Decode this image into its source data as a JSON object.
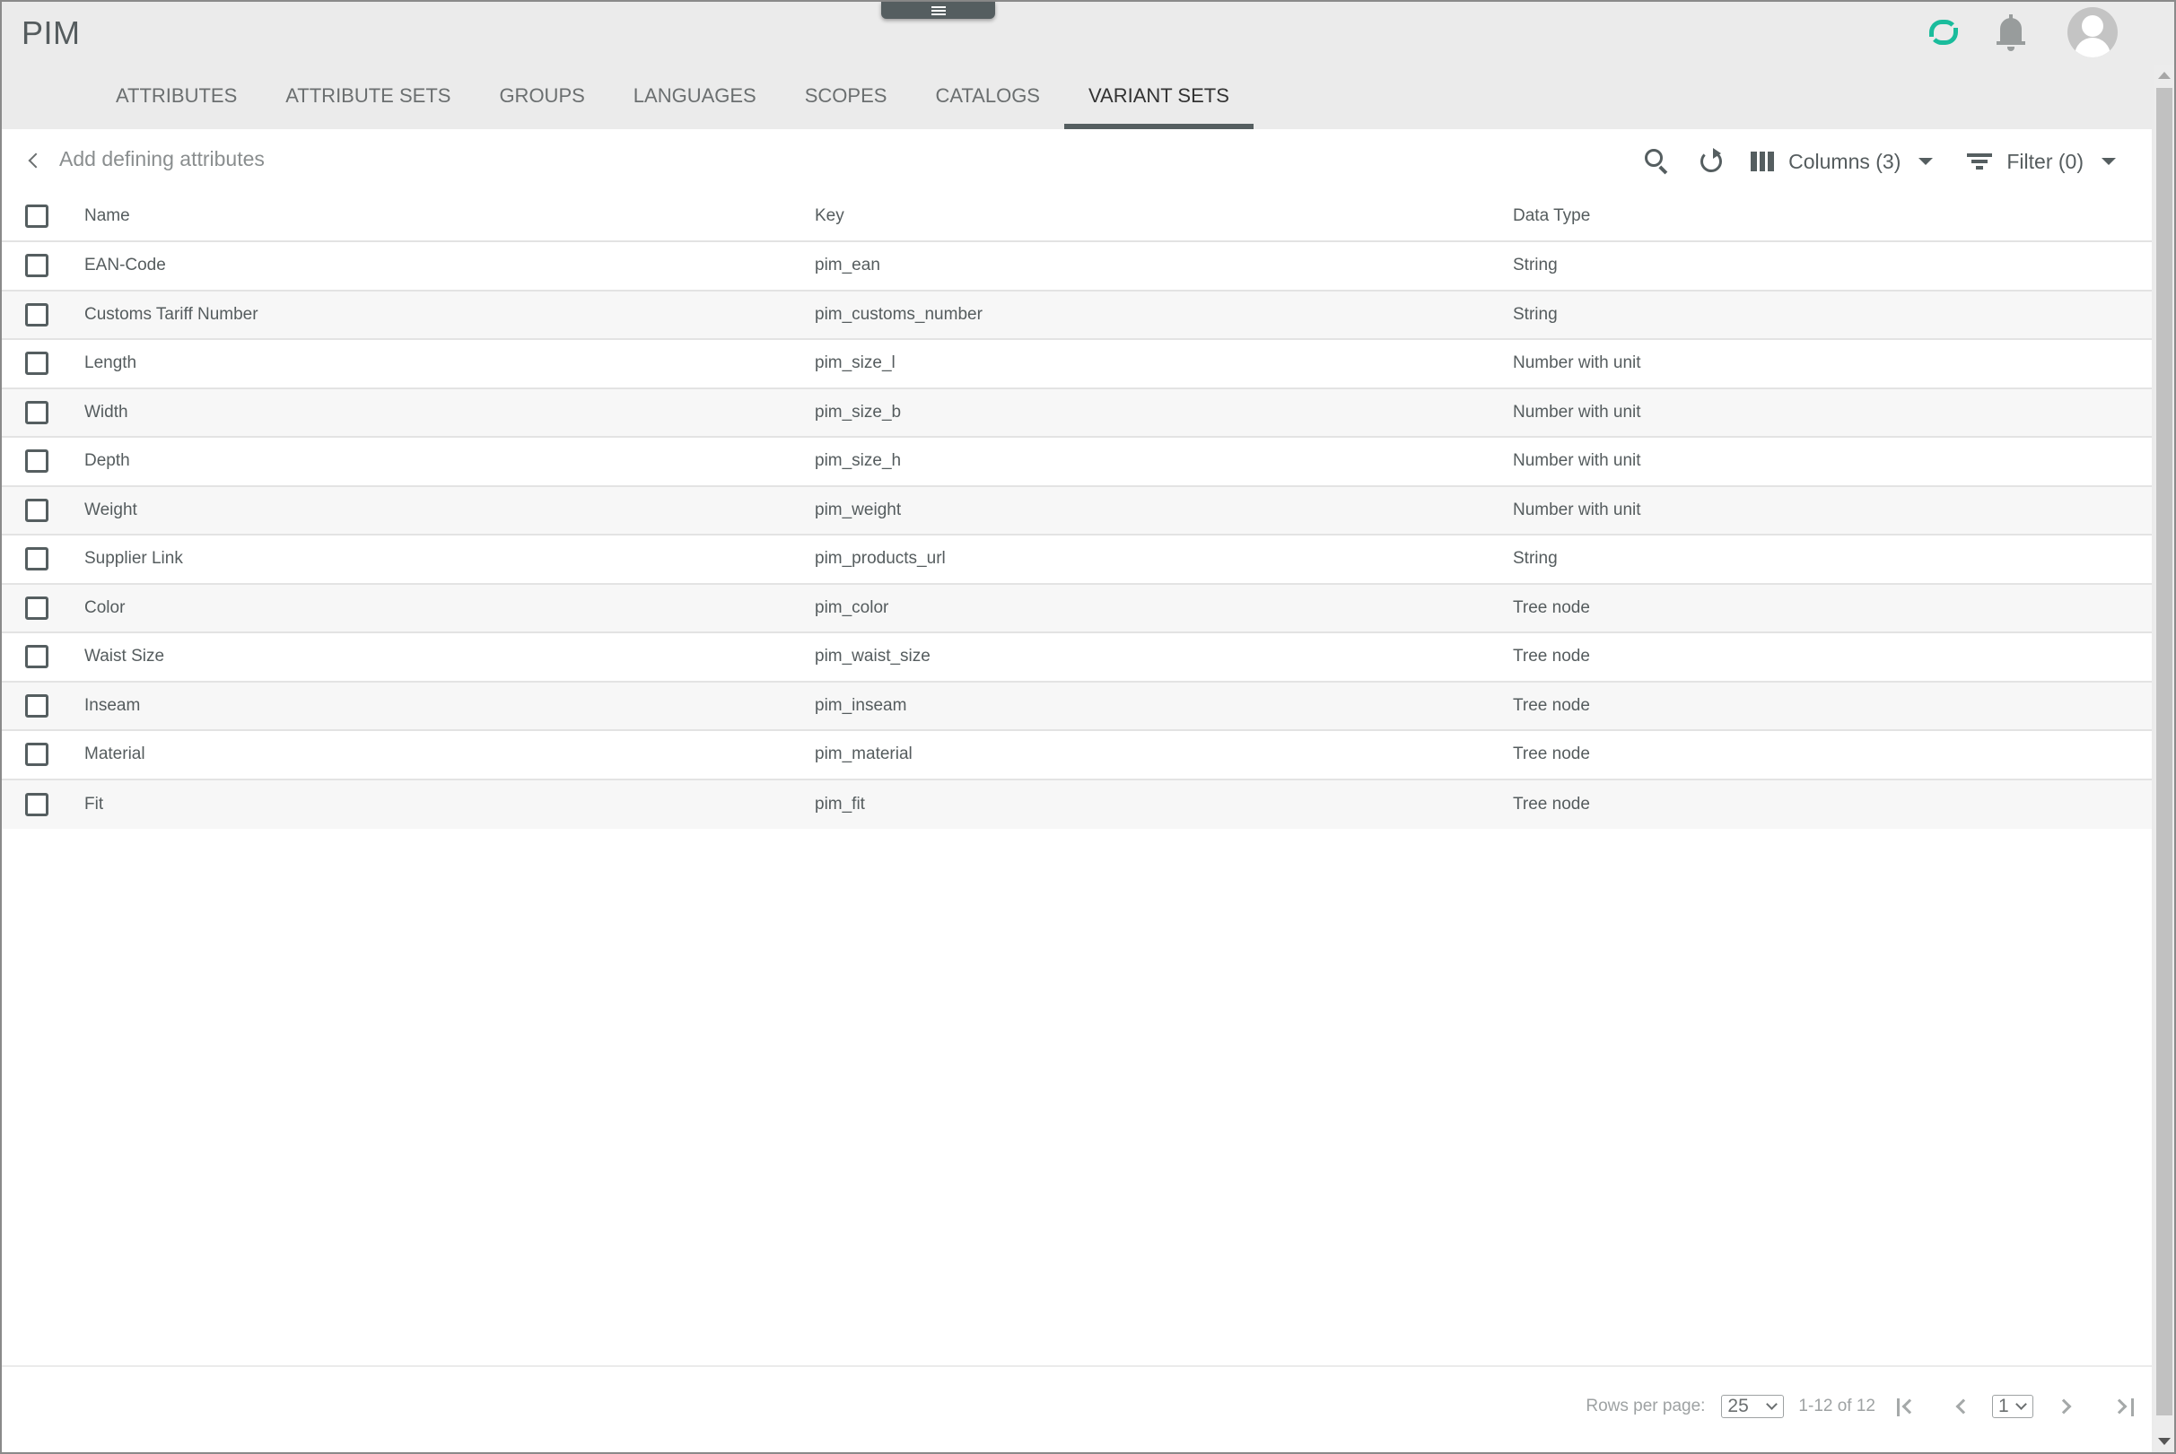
{
  "app": {
    "title": "PIM"
  },
  "header": {
    "icons": [
      "menu-handle-icon",
      "loading-spinner-icon",
      "bell-icon",
      "user-avatar-icon"
    ]
  },
  "tabs": [
    {
      "label": "ATTRIBUTES",
      "active": false
    },
    {
      "label": "ATTRIBUTE SETS",
      "active": false
    },
    {
      "label": "GROUPS",
      "active": false
    },
    {
      "label": "LANGUAGES",
      "active": false
    },
    {
      "label": "SCOPES",
      "active": false
    },
    {
      "label": "CATALOGS",
      "active": false
    },
    {
      "label": "VARIANT SETS",
      "active": true
    }
  ],
  "toolbar": {
    "title": "Add defining attributes",
    "columns_label": "Columns (3)",
    "filter_label": "Filter (0)"
  },
  "table": {
    "columns": [
      "Name",
      "Key",
      "Data Type"
    ],
    "rows": [
      {
        "name": "EAN-Code",
        "key": "pim_ean",
        "type": "String",
        "checked": false
      },
      {
        "name": "Customs Tariff Number",
        "key": "pim_customs_number",
        "type": "String",
        "checked": false
      },
      {
        "name": "Length",
        "key": "pim_size_l",
        "type": "Number with unit",
        "checked": false
      },
      {
        "name": "Width",
        "key": "pim_size_b",
        "type": "Number with unit",
        "checked": false
      },
      {
        "name": "Depth",
        "key": "pim_size_h",
        "type": "Number with unit",
        "checked": false
      },
      {
        "name": "Weight",
        "key": "pim_weight",
        "type": "Number with unit",
        "checked": false
      },
      {
        "name": "Supplier Link",
        "key": "pim_products_url",
        "type": "String",
        "checked": false
      },
      {
        "name": "Color",
        "key": "pim_color",
        "type": "Tree node",
        "checked": false
      },
      {
        "name": "Waist Size",
        "key": "pim_waist_size",
        "type": "Tree node",
        "checked": false
      },
      {
        "name": "Inseam",
        "key": "pim_inseam",
        "type": "Tree node",
        "checked": false
      },
      {
        "name": "Material",
        "key": "pim_material",
        "type": "Tree node",
        "checked": false
      },
      {
        "name": "Fit",
        "key": "pim_fit",
        "type": "Tree node",
        "checked": false
      }
    ]
  },
  "pagination": {
    "rows_per_page_label": "Rows per page:",
    "rows_per_page_value": "25",
    "range_text": "1-12 of 12",
    "current_page": "1"
  },
  "colors": {
    "accent_spinner": "#1abc9c",
    "primary_dark": "#555e60",
    "header_bg": "#ebebeb"
  }
}
